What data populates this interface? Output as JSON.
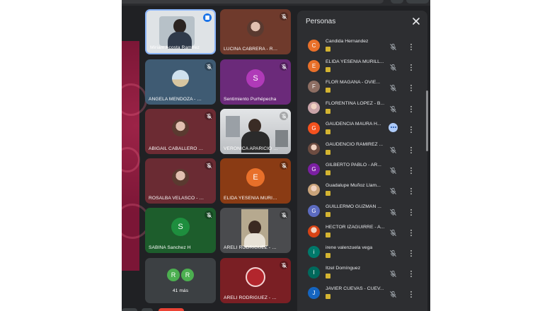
{
  "meet": {
    "grid": [
      {
        "name": "Miriam Acosta Ramirez",
        "status": "speaking",
        "kind": "camera",
        "bg": "#dfe3e6"
      },
      {
        "name": "LUCINA CABRERA - ROJAS",
        "status": "muted",
        "kind": "avatar-photo",
        "bg": "#6f3a2c"
      },
      {
        "name": "ANGELA MENDOZA - PER...",
        "status": "muted",
        "kind": "avatar-photo",
        "bg": "#3f5b73"
      },
      {
        "name": "Sentimiento Purhépecha",
        "status": "muted",
        "kind": "avatar-letter",
        "letter": "S",
        "bg": "#6b2a7a",
        "avatar_color": "#b03ab8"
      },
      {
        "name": "ABIGAIL CABALLERO - RA...",
        "status": "muted",
        "kind": "avatar-photo",
        "bg": "#6c2b33"
      },
      {
        "name": "VERONICA APARICIO - MI...",
        "status": "muted",
        "kind": "camera",
        "bg": "#cfd3d6"
      },
      {
        "name": "ROSALBA VELASCO - LOP...",
        "status": "muted",
        "kind": "avatar-photo",
        "bg": "#6a2b33"
      },
      {
        "name": "ELIDA YESENIA MURILLO -...",
        "status": "muted",
        "kind": "avatar-letter",
        "letter": "E",
        "bg": "#8a3b14",
        "avatar_color": "#e8702a"
      },
      {
        "name": "SABINA Sanchez H",
        "status": "muted",
        "kind": "avatar-letter",
        "letter": "S",
        "bg": "#1d5d2c",
        "avatar_color": "#1e8e3e"
      },
      {
        "name": "ARELI RODRIGUEZ - REYES",
        "status": "muted",
        "kind": "camera-small",
        "bg": "#4a4b4e"
      },
      {
        "name": "41 más",
        "status": "none",
        "kind": "more",
        "letters": [
          "R",
          "R"
        ],
        "bg": "#3c4043",
        "avatar_color": "#4caf50"
      },
      {
        "name": "ARELI RODRIGUEZ - REYES",
        "status": "muted",
        "kind": "avatar-ring",
        "bg": "#7a1f24"
      }
    ],
    "panel": {
      "title": "Personas",
      "participants": [
        {
          "name": "Candida Hernandez",
          "letter": "C",
          "color": "#e8702a",
          "state": "muted"
        },
        {
          "name": "ELIDA YESENIA MURILL...",
          "letter": "E",
          "color": "#e8702a",
          "state": "muted"
        },
        {
          "name": "FLOR MAGAÑA - OVIE...",
          "letter": "F",
          "color": "#8d6e63",
          "state": "muted"
        },
        {
          "name": "FLORENTINA LOPEZ - B...",
          "letter": "",
          "color": "#c9a3a8",
          "state": "muted"
        },
        {
          "name": "GAUDENCIA MAURA H...",
          "letter": "G",
          "color": "#f4511e",
          "state": "speaking"
        },
        {
          "name": "GAUDENCIO RAMIREZ ...",
          "letter": "",
          "color": "#6d4c41",
          "state": "muted"
        },
        {
          "name": "GILBERTO PABLO - AR...",
          "letter": "G",
          "color": "#7b1fa2",
          "state": "muted"
        },
        {
          "name": "Guadalupe Muñoz Llam...",
          "letter": "",
          "color": "#c9a37a",
          "state": "muted"
        },
        {
          "name": "GUILLERMO GUZMAN ...",
          "letter": "G",
          "color": "#5c6bc0",
          "state": "muted"
        },
        {
          "name": "HECTOR IZAGUIRRE - A...",
          "letter": "",
          "color": "#d84315",
          "state": "muted"
        },
        {
          "name": "irene valenzuela vega",
          "letter": "i",
          "color": "#00796b",
          "state": "muted"
        },
        {
          "name": "Itzel Domínguez",
          "letter": "I",
          "color": "#00695c",
          "state": "muted"
        },
        {
          "name": "JAVIER CUEVAS - CUEV...",
          "letter": "J",
          "color": "#1565c0",
          "state": "muted"
        }
      ]
    }
  }
}
